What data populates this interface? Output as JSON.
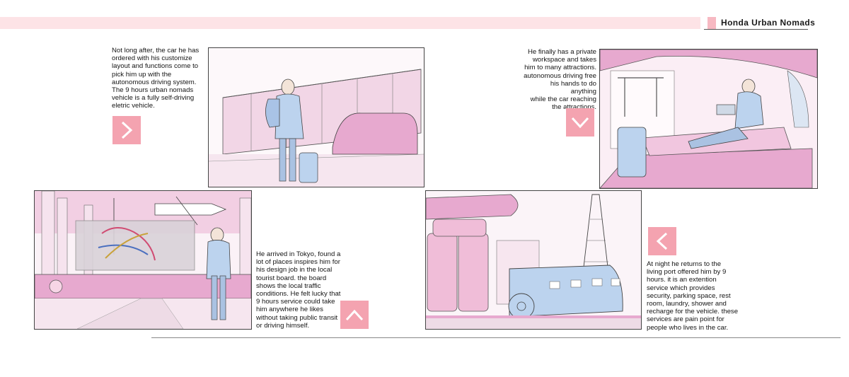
{
  "header": {
    "title": "Honda Urban Nomads"
  },
  "captions": {
    "c1": "Not long after, the car he has\nordered with his customize\nlayout and functions come to\npick him up with the\nautonomous driving system.\nThe 9 hours urban nomads\nvehicle is a fully self-driving\neletric vehicle.",
    "c2": "He finally has a private\nworkspace and takes\nhim to many attractions.\nautonomous driving free\nhis hands to do anything\nwhile the car reaching\nthe attractions.",
    "c3": "He arrived in Tokyo,  found a\nlot of places inspires him for\nhis design job in the local\ntourist board. the board\nshows the local traffic\nconditions. He felt lucky that\n9 hours service could take\nhim anywhere he likes\nwithout taking public transit\nor driving himself.",
    "c4": "At night he returns to the\nliving port offered him by 9\nhours. it is an extention\nservice which provides\nsecurity, parking space, rest\nroom, laundry, shower and\nrecharge for the vehicle. these\nservices are pain point for\npeople who lives in the car."
  },
  "panels": {
    "p1": "station-pickup-sketch",
    "p2": "vehicle-workspace-sketch",
    "p3": "tokyo-board-sketch",
    "p4": "living-port-sketch"
  },
  "colors": {
    "accent": "#f4a3b0",
    "band": "#fde3e6",
    "pink": "#e7a9cf",
    "blue": "#bcd3ee"
  }
}
